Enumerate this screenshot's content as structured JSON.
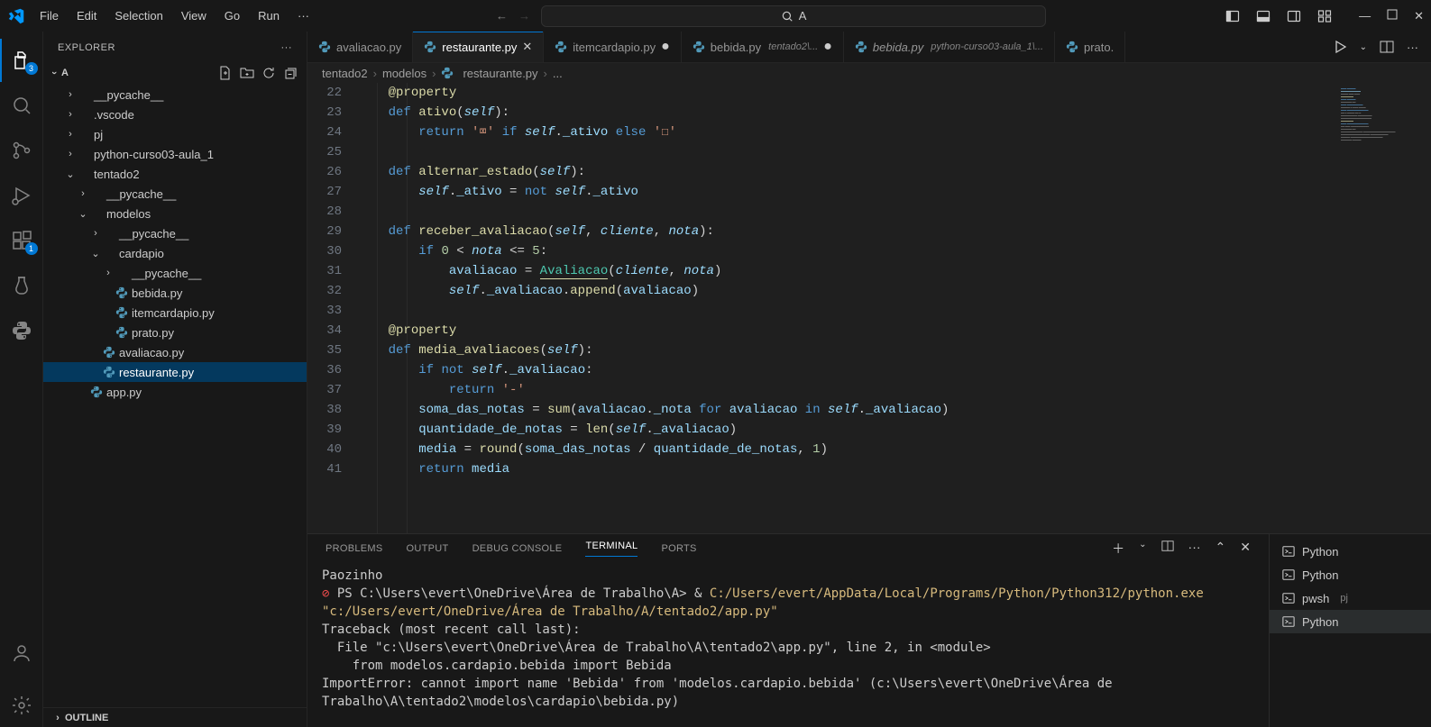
{
  "menu": {
    "file": "File",
    "edit": "Edit",
    "selection": "Selection",
    "view": "View",
    "go": "Go",
    "run": "Run",
    "more": "···"
  },
  "search_center_text": "A",
  "activity": {
    "explorer_badge": "3",
    "ext_badge": "1"
  },
  "explorer": {
    "title": "EXPLORER",
    "root": "A",
    "tree": [
      {
        "type": "folder",
        "name": "__pycache__",
        "depth": 1,
        "open": false
      },
      {
        "type": "folder",
        "name": ".vscode",
        "depth": 1,
        "open": false
      },
      {
        "type": "folder",
        "name": "pj",
        "depth": 1,
        "open": false
      },
      {
        "type": "folder",
        "name": "python-curso03-aula_1",
        "depth": 1,
        "open": false
      },
      {
        "type": "folder",
        "name": "tentado2",
        "depth": 1,
        "open": true
      },
      {
        "type": "folder",
        "name": "__pycache__",
        "depth": 2,
        "open": false
      },
      {
        "type": "folder",
        "name": "modelos",
        "depth": 2,
        "open": true
      },
      {
        "type": "folder",
        "name": "__pycache__",
        "depth": 3,
        "open": false
      },
      {
        "type": "folder",
        "name": "cardapio",
        "depth": 3,
        "open": true
      },
      {
        "type": "folder",
        "name": "__pycache__",
        "depth": 4,
        "open": false
      },
      {
        "type": "file",
        "name": "bebida.py",
        "depth": 4
      },
      {
        "type": "file",
        "name": "itemcardapio.py",
        "depth": 4
      },
      {
        "type": "file",
        "name": "prato.py",
        "depth": 4
      },
      {
        "type": "file",
        "name": "avaliacao.py",
        "depth": 3
      },
      {
        "type": "file",
        "name": "restaurante.py",
        "depth": 3,
        "selected": true
      },
      {
        "type": "file",
        "name": "app.py",
        "depth": 2
      }
    ],
    "outline": "OUTLINE"
  },
  "tabs": [
    {
      "name": "avaliacao.py",
      "icon": "py",
      "active": false,
      "dirty": false
    },
    {
      "name": "restaurante.py",
      "icon": "py",
      "active": true,
      "dirty": false,
      "close": true
    },
    {
      "name": "itemcardapio.py",
      "icon": "py",
      "active": false,
      "dirty": true
    },
    {
      "name": "bebida.py",
      "icon": "py",
      "active": false,
      "dirty": true,
      "subtitle": "tentado2\\..."
    },
    {
      "name": "bebida.py",
      "icon": "py",
      "active": false,
      "dirty": false,
      "italic": true,
      "subtitle": "python-curso03-aula_1\\..."
    },
    {
      "name": "prato.",
      "icon": "py",
      "active": false,
      "dirty": false,
      "cut": true
    }
  ],
  "breadcrumb": [
    "tentado2",
    "modelos",
    "restaurante.py",
    "..."
  ],
  "code": {
    "start": 22,
    "lines": [
      [
        [
          "dec",
          "@property"
        ]
      ],
      [
        [
          "k",
          "def "
        ],
        [
          "fnname",
          "ativo"
        ],
        [
          "punc",
          "("
        ],
        [
          "self",
          "self"
        ],
        [
          "punc",
          ")"
        ],
        [
          "punc",
          ":"
        ]
      ],
      [
        [
          "sp",
          "    "
        ],
        [
          "k",
          "return"
        ],
        [
          "op",
          " "
        ],
        [
          "str",
          "'⌧'"
        ],
        [
          "op",
          " "
        ],
        [
          "k",
          "if"
        ],
        [
          "op",
          " "
        ],
        [
          "self",
          "self"
        ],
        [
          "punc",
          "."
        ],
        [
          "var",
          "_ativo"
        ],
        [
          "op",
          " "
        ],
        [
          "k",
          "else"
        ],
        [
          "op",
          " "
        ],
        [
          "str",
          "'☐'"
        ]
      ],
      [],
      [
        [
          "k",
          "def "
        ],
        [
          "fnname",
          "alternar_estado"
        ],
        [
          "punc",
          "("
        ],
        [
          "self",
          "self"
        ],
        [
          "punc",
          ")"
        ],
        [
          "punc",
          ":"
        ]
      ],
      [
        [
          "sp",
          "    "
        ],
        [
          "self",
          "self"
        ],
        [
          "punc",
          "."
        ],
        [
          "var",
          "_ativo"
        ],
        [
          "op",
          " = "
        ],
        [
          "k",
          "not"
        ],
        [
          "op",
          " "
        ],
        [
          "self",
          "self"
        ],
        [
          "punc",
          "."
        ],
        [
          "var",
          "_ativo"
        ]
      ],
      [],
      [
        [
          "k",
          "def "
        ],
        [
          "fnname",
          "receber_avaliacao"
        ],
        [
          "punc",
          "("
        ],
        [
          "self",
          "self"
        ],
        [
          "punc",
          ", "
        ],
        [
          "param",
          "cliente"
        ],
        [
          "punc",
          ", "
        ],
        [
          "param",
          "nota"
        ],
        [
          "punc",
          ")"
        ],
        [
          "punc",
          ":"
        ]
      ],
      [
        [
          "sp",
          "    "
        ],
        [
          "k",
          "if"
        ],
        [
          "op",
          " "
        ],
        [
          "num",
          "0"
        ],
        [
          "op",
          " < "
        ],
        [
          "param",
          "nota"
        ],
        [
          "op",
          " <= "
        ],
        [
          "num",
          "5"
        ],
        [
          "punc",
          ":"
        ]
      ],
      [
        [
          "sp",
          "        "
        ],
        [
          "var",
          "avaliacao"
        ],
        [
          "op",
          " = "
        ],
        [
          "cls",
          "Avaliacao",
          true
        ],
        [
          "punc",
          "("
        ],
        [
          "param",
          "cliente"
        ],
        [
          "punc",
          ", "
        ],
        [
          "param",
          "nota"
        ],
        [
          "punc",
          ")"
        ]
      ],
      [
        [
          "sp",
          "        "
        ],
        [
          "self",
          "self"
        ],
        [
          "punc",
          "."
        ],
        [
          "var",
          "_avaliacao"
        ],
        [
          "punc",
          "."
        ],
        [
          "prop",
          "append"
        ],
        [
          "punc",
          "("
        ],
        [
          "var",
          "avaliacao"
        ],
        [
          "punc",
          ")"
        ]
      ],
      [],
      [
        [
          "dec",
          "@property"
        ]
      ],
      [
        [
          "k",
          "def "
        ],
        [
          "fnname",
          "media_avaliacoes"
        ],
        [
          "punc",
          "("
        ],
        [
          "self",
          "self"
        ],
        [
          "punc",
          ")"
        ],
        [
          "punc",
          ":"
        ]
      ],
      [
        [
          "sp",
          "    "
        ],
        [
          "k",
          "if"
        ],
        [
          "op",
          " "
        ],
        [
          "k",
          "not"
        ],
        [
          "op",
          " "
        ],
        [
          "self",
          "self"
        ],
        [
          "punc",
          "."
        ],
        [
          "var",
          "_avaliacao"
        ],
        [
          "punc",
          ":"
        ]
      ],
      [
        [
          "sp",
          "        "
        ],
        [
          "k",
          "return"
        ],
        [
          "op",
          " "
        ],
        [
          "str",
          "'-'"
        ]
      ],
      [
        [
          "sp",
          "    "
        ],
        [
          "var",
          "soma_das_notas"
        ],
        [
          "op",
          " = "
        ],
        [
          "prop",
          "sum"
        ],
        [
          "punc",
          "("
        ],
        [
          "var",
          "avaliacao"
        ],
        [
          "punc",
          "."
        ],
        [
          "var",
          "_nota"
        ],
        [
          "op",
          " "
        ],
        [
          "k",
          "for"
        ],
        [
          "op",
          " "
        ],
        [
          "var",
          "avaliacao"
        ],
        [
          "op",
          " "
        ],
        [
          "k",
          "in"
        ],
        [
          "op",
          " "
        ],
        [
          "self",
          "self"
        ],
        [
          "punc",
          "."
        ],
        [
          "var",
          "_avaliacao"
        ],
        [
          "punc",
          ")"
        ]
      ],
      [
        [
          "sp",
          "    "
        ],
        [
          "var",
          "quantidade_de_notas"
        ],
        [
          "op",
          " = "
        ],
        [
          "prop",
          "len"
        ],
        [
          "punc",
          "("
        ],
        [
          "self",
          "self"
        ],
        [
          "punc",
          "."
        ],
        [
          "var",
          "_avaliacao"
        ],
        [
          "punc",
          ")"
        ]
      ],
      [
        [
          "sp",
          "    "
        ],
        [
          "var",
          "media"
        ],
        [
          "op",
          " = "
        ],
        [
          "prop",
          "round"
        ],
        [
          "punc",
          "("
        ],
        [
          "var",
          "soma_das_notas"
        ],
        [
          "op",
          " / "
        ],
        [
          "var",
          "quantidade_de_notas"
        ],
        [
          "punc",
          ", "
        ],
        [
          "num",
          "1"
        ],
        [
          "punc",
          ")"
        ]
      ],
      [
        [
          "sp",
          "    "
        ],
        [
          "k",
          "return"
        ],
        [
          "op",
          " "
        ],
        [
          "var",
          "media"
        ]
      ]
    ]
  },
  "panel": {
    "tabs": {
      "problems": "PROBLEMS",
      "output": "OUTPUT",
      "debug": "DEBUG CONSOLE",
      "terminal": "TERMINAL",
      "ports": "PORTS"
    },
    "terminal_items": [
      {
        "name": "Python"
      },
      {
        "name": "Python"
      },
      {
        "name": "pwsh",
        "sub": "pj"
      },
      {
        "name": "Python",
        "active": true
      }
    ],
    "terminal_text": {
      "l1": "Paozinho",
      "l2_prefix": "PS C:\\Users\\evert\\OneDrive\\Área de Trabalho\\A> ",
      "l2_amp": "& ",
      "l2_cmd": "C:/Users/evert/AppData/Local/Programs/Python/Python312/python.exe",
      "l3": "\"c:/Users/evert/OneDrive/Área de Trabalho/A/tentado2/app.py\"",
      "l4": "Traceback (most recent call last):",
      "l5": "  File \"c:\\Users\\evert\\OneDrive\\Área de Trabalho\\A\\tentado2\\app.py\", line 2, in <module>",
      "l6": "    from modelos.cardapio.bebida import Bebida",
      "l7": "ImportError: cannot import name 'Bebida' from 'modelos.cardapio.bebida' (c:\\Users\\evert\\OneDrive\\Área de Trabalho\\A\\tentado2\\modelos\\cardapio\\bebida.py)"
    }
  }
}
